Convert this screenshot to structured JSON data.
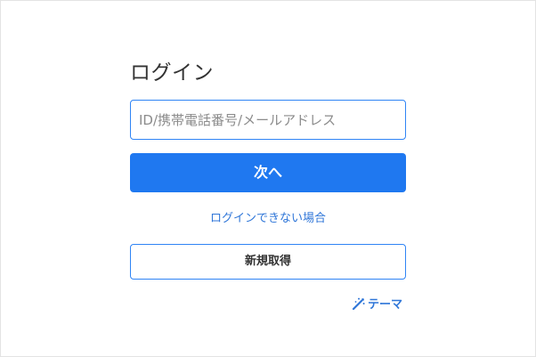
{
  "login": {
    "title": "ログイン",
    "id_input": {
      "value": "",
      "placeholder": "ID/携帯電話番号/メールアドレス"
    },
    "next_label": "次へ",
    "trouble_link_label": "ログインできない場合",
    "register_label": "新規取得",
    "theme_label": "テーマ"
  },
  "colors": {
    "primary": "#1f78f0",
    "link": "#2f76d8",
    "input_border": "#2f84f5"
  },
  "icons": {
    "theme": "magic-wand-icon"
  }
}
